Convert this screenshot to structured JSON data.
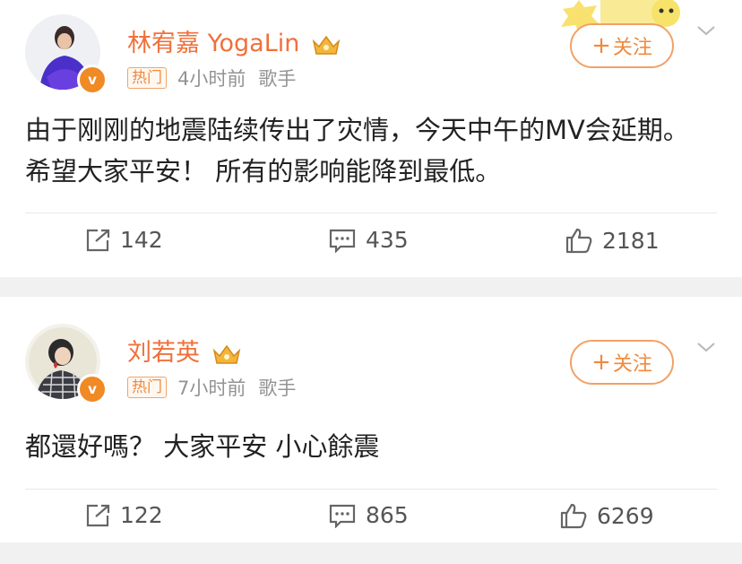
{
  "posts": [
    {
      "author": "林宥嘉 YogaLin",
      "hot_tag": "热门",
      "time": "4小时前",
      "role": "歌手",
      "follow_label": "关注",
      "text": "由于刚刚的地震陆续传出了灾情，今天中午的MV会延期。 希望大家平安！ 所有的影响能降到最低。",
      "reposts": "142",
      "comments": "435",
      "likes": "2181"
    },
    {
      "author": "刘若英",
      "hot_tag": "热门",
      "time": "7小时前",
      "role": "歌手",
      "follow_label": "关注",
      "text": "都還好嗎？ 大家平安 小心餘震",
      "reposts": "122",
      "comments": "865",
      "likes": "6269"
    }
  ],
  "icons": {
    "verified": "verified-badge-icon",
    "crown": "vip-crown-icon",
    "repost": "repost-icon",
    "comment": "comment-icon",
    "like": "like-icon",
    "more": "chevron-down-icon"
  },
  "colors": {
    "name": "#f0703a",
    "accent": "#f08a3c",
    "meta": "#939393",
    "verified": "#f08a24"
  }
}
